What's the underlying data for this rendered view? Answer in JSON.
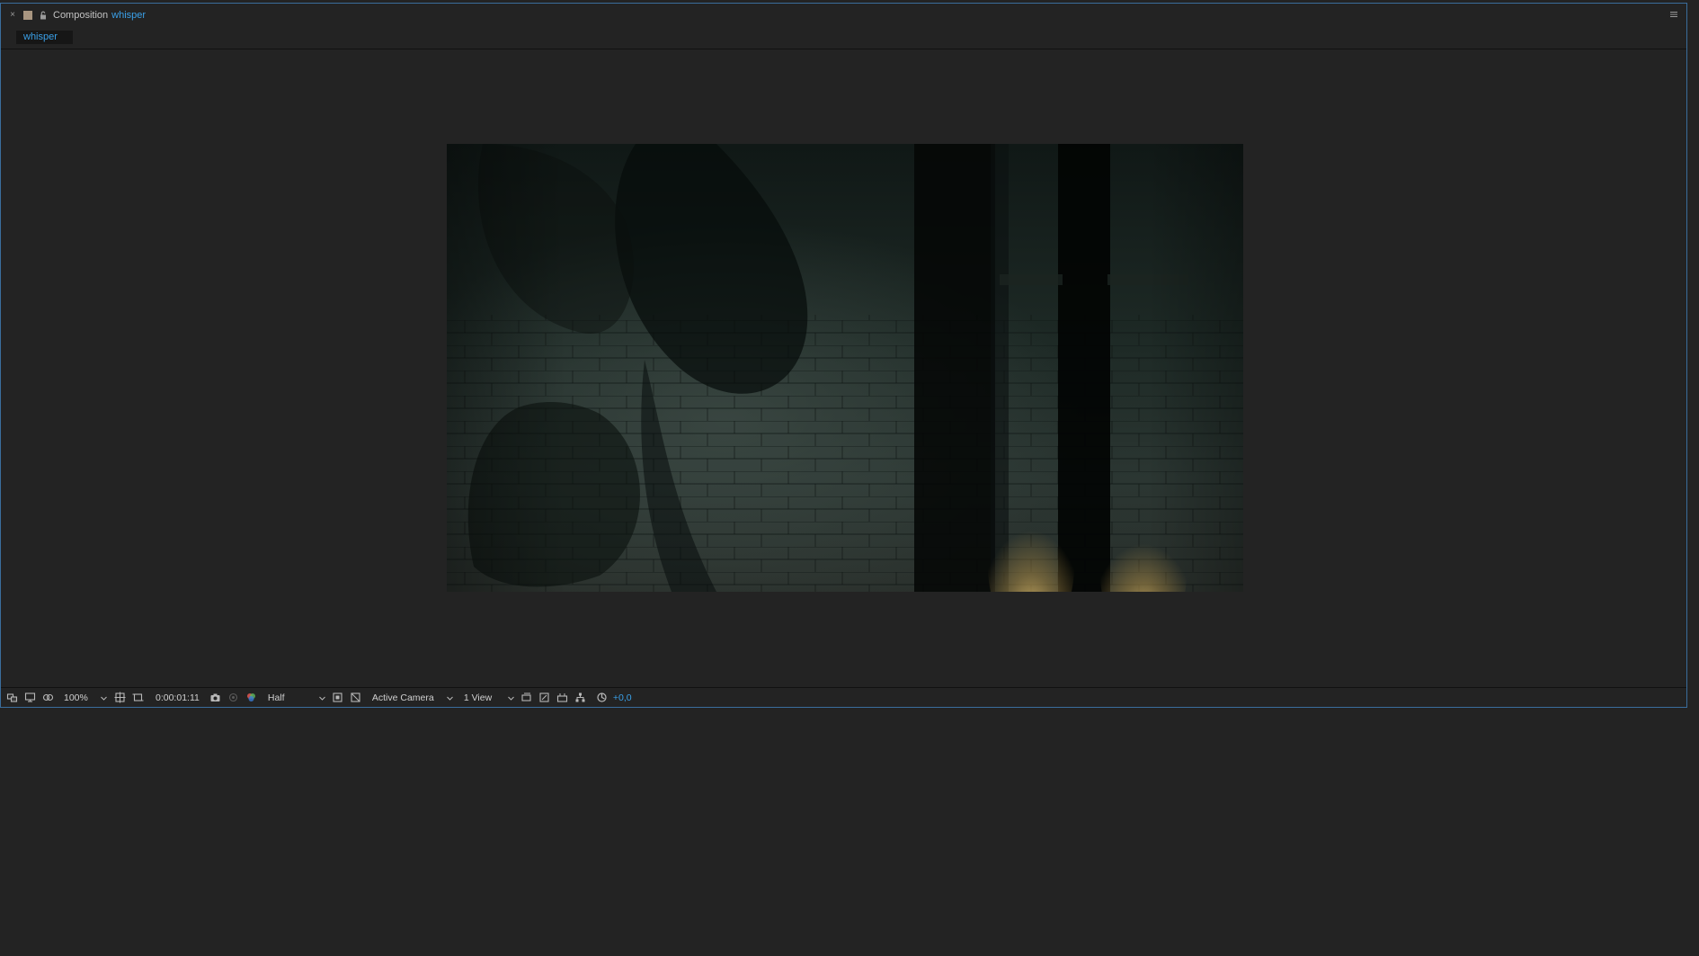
{
  "panel": {
    "close_glyph": "×",
    "title_prefix": "Composition",
    "comp_name": "whisper",
    "swatch_color": "#a89580",
    "accent_color": "#3aa0e8",
    "border_color": "#3a6d9c",
    "menu_icon": "hamburger-icon",
    "lock_icon": "lock-icon"
  },
  "tabs": [
    {
      "label": "whisper",
      "active": true
    }
  ],
  "toolbar": {
    "magnification": "100%",
    "timecode": "0:00:01:11",
    "resolution": "Half",
    "camera": "Active Camera",
    "view_layout": "1 View",
    "exposure": "+0,0",
    "icons": [
      "always-preview-icon",
      "monitor-icon",
      "mask-visibility-icon",
      "choose-grid-icon",
      "region-of-interest-icon",
      "snapshot-icon",
      "show-snapshot-icon",
      "color-channel-icon",
      "fast-previews-icon",
      "transparency-grid-icon",
      "3d-view-icon",
      "draft-3d-icon",
      "flowchart-icon",
      "reset-exposure-icon"
    ]
  },
  "viewer": {
    "background_color": "#232323"
  }
}
